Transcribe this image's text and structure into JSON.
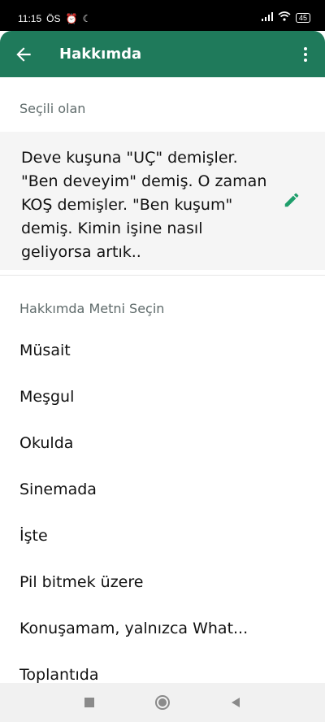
{
  "status": {
    "time": "11:15",
    "carrier": "ÖS",
    "battery": "45"
  },
  "appbar": {
    "title": "Hakkımda"
  },
  "current": {
    "label": "Seçili olan",
    "text": "Deve kuşuna \"UÇ\" demişler. \"Ben deveyim\" demiş. O zaman KOŞ demişler. \"Ben kuşum\" demiş. Kimin işine nasıl geliyorsa artık.."
  },
  "choose": {
    "label": "Hakkımda Metni Seçin"
  },
  "items": [
    "Müsait",
    "Meşgul",
    "Okulda",
    "Sinemada",
    "İşte",
    "Pil bitmek üzere",
    "Konuşamam, yalnızca What...",
    "Toplantıda"
  ],
  "colors": {
    "primary": "#1f7a5b",
    "accent": "#1e9e6b"
  }
}
